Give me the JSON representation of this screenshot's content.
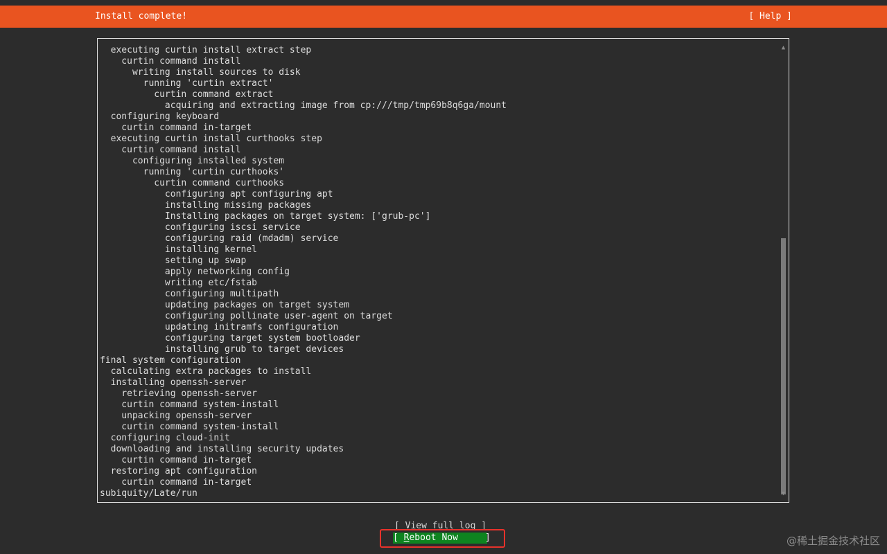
{
  "header": {
    "title": "Install complete!",
    "help_label": "[ Help ]"
  },
  "log": {
    "lines": [
      "  executing curtin install extract step",
      "    curtin command install",
      "      writing install sources to disk",
      "        running 'curtin extract'",
      "          curtin command extract",
      "            acquiring and extracting image from cp:///tmp/tmp69b8q6ga/mount",
      "  configuring keyboard",
      "    curtin command in-target",
      "  executing curtin install curthooks step",
      "    curtin command install",
      "      configuring installed system",
      "        running 'curtin curthooks'",
      "          curtin command curthooks",
      "            configuring apt configuring apt",
      "            installing missing packages",
      "            Installing packages on target system: ['grub-pc']",
      "            configuring iscsi service",
      "            configuring raid (mdadm) service",
      "            installing kernel",
      "            setting up swap",
      "            apply networking config",
      "            writing etc/fstab",
      "            configuring multipath",
      "            updating packages on target system",
      "            configuring pollinate user-agent on target",
      "            updating initramfs configuration",
      "            configuring target system bootloader",
      "            installing grub to target devices",
      "final system configuration",
      "  calculating extra packages to install",
      "  installing openssh-server",
      "    retrieving openssh-server",
      "    curtin command system-install",
      "    unpacking openssh-server",
      "    curtin command system-install",
      "  configuring cloud-init",
      "  downloading and installing security updates",
      "    curtin command in-target",
      "  restoring apt configuration",
      "    curtin command in-target",
      "subiquity/Late/run"
    ],
    "scroll_up_glyph": "▲",
    "scroll_down_glyph": "▼"
  },
  "buttons": {
    "view_log_label": "[ View full log ]",
    "reboot_prefix": "[ ",
    "reboot_hotkey": "R",
    "reboot_rest": "eboot Now     ]"
  },
  "watermark": "@稀土掘金技术社区",
  "colors": {
    "header_bg": "#e95420",
    "button_bg": "#0e8420",
    "highlight": "#e8322b",
    "background": "#2c2c2c"
  }
}
